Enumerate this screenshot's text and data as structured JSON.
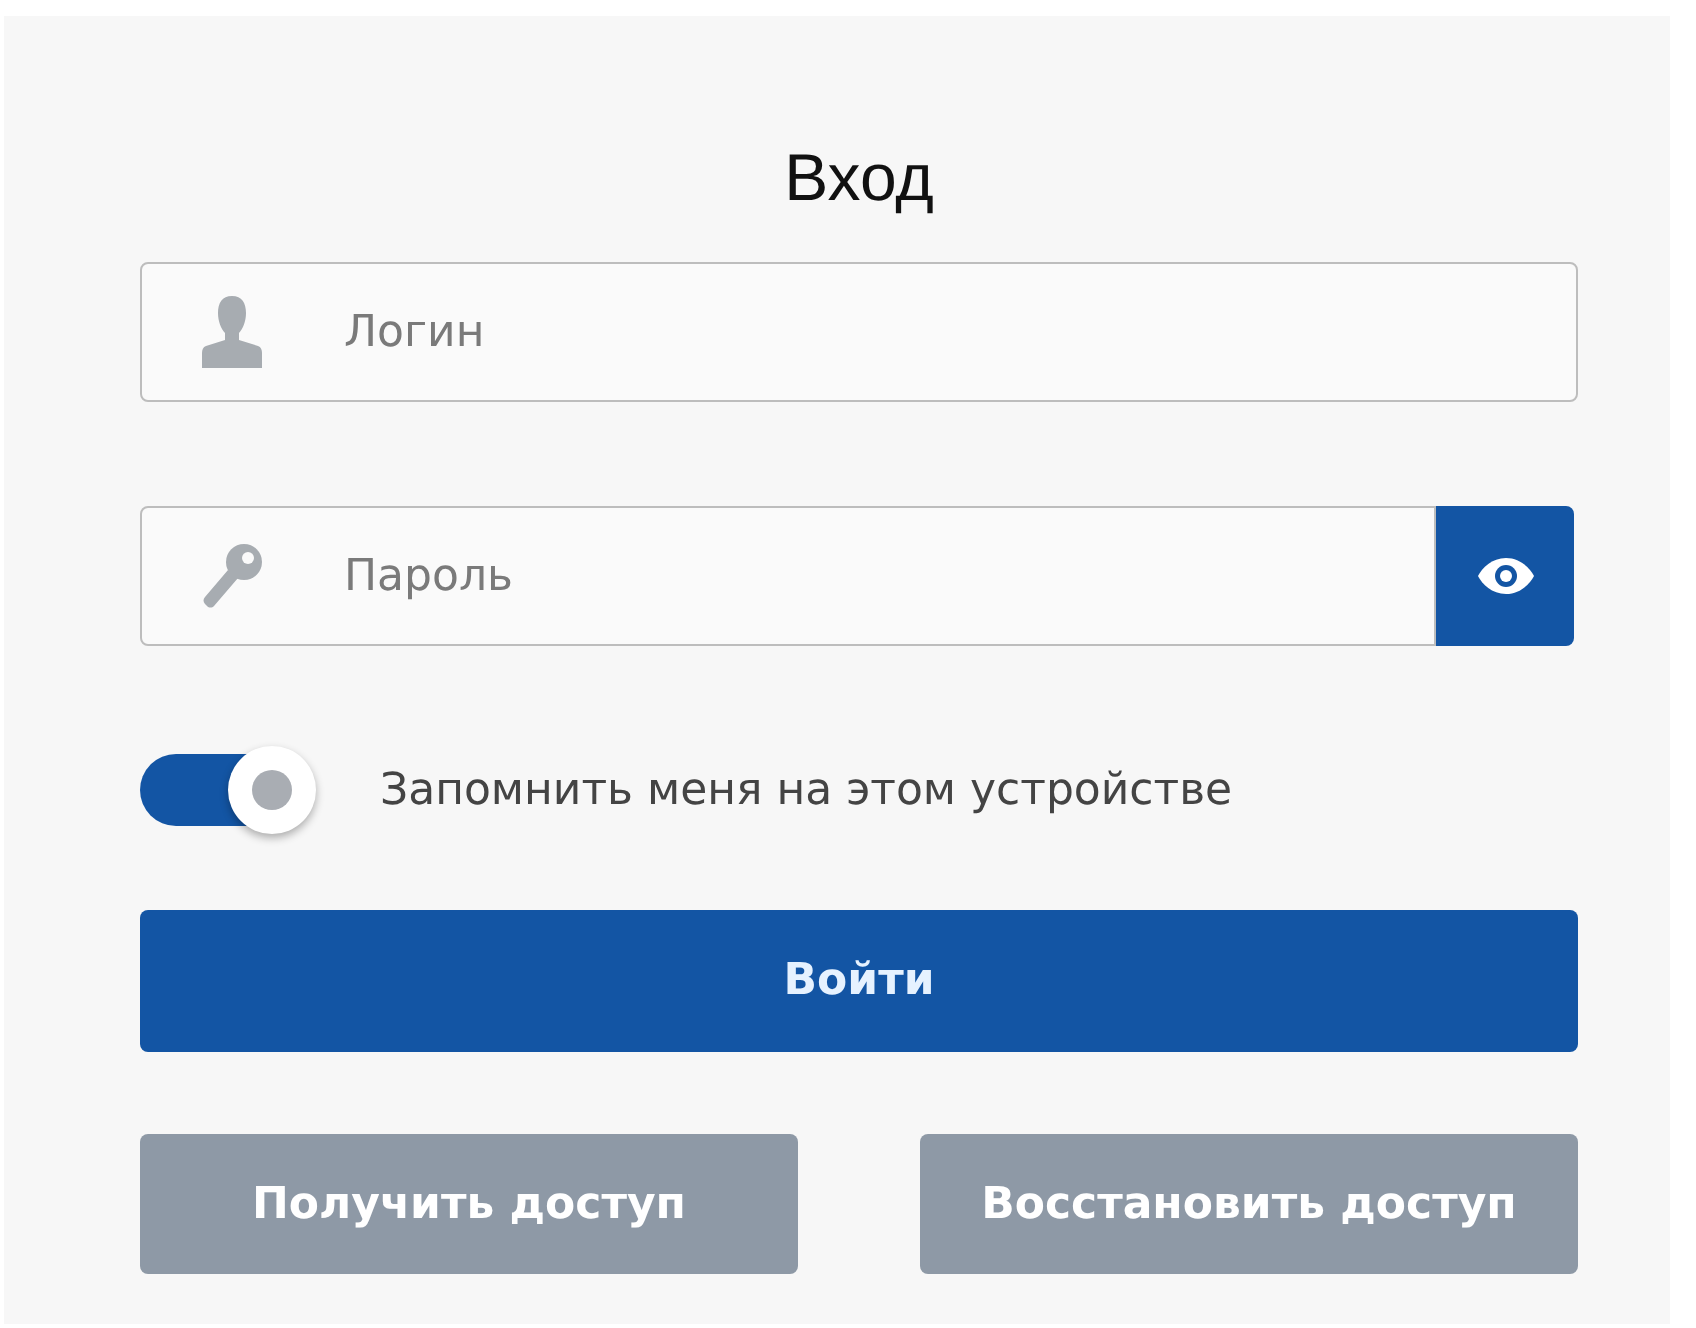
{
  "title": "Вход",
  "login_field": {
    "placeholder": "Логин"
  },
  "password_field": {
    "placeholder": "Пароль"
  },
  "remember": {
    "label": "Запомнить меня на этом устройстве",
    "on": true
  },
  "submit_button": "Войти",
  "secondary_buttons": [
    "Получить доступ",
    "Восстановить доступ"
  ]
}
